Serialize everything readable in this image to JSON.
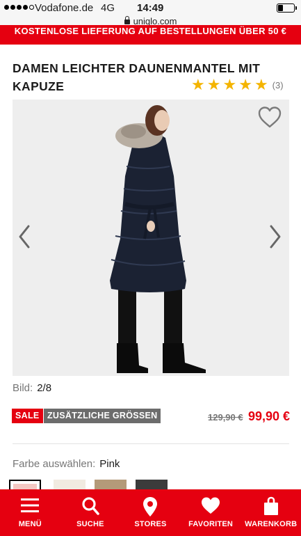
{
  "status_bar": {
    "carrier": "Vodafone.de",
    "network": "4G",
    "time": "14:49",
    "url": "uniqlo.com"
  },
  "promo_banner": {
    "text": "KOSTENLOSE LIEFERUNG AUF BESTELLUNGEN ÜBER 50 €"
  },
  "product": {
    "title": "DAMEN LEICHTER DAUNENMANTEL MIT KAPUZE",
    "rating": {
      "stars": 5,
      "filled": 5,
      "count": "(3)",
      "star_color": "#f4b400"
    },
    "image_counter": {
      "label": "Bild:",
      "value": "2/8"
    },
    "badges": {
      "sale": "SALE",
      "sizes": "ZUSÄTZLICHE GRÖSSEN"
    },
    "price": {
      "old": "129,90 €",
      "new": "99,90 €"
    },
    "color": {
      "label": "Farbe auswählen:",
      "value": "Pink"
    },
    "swatches": [
      {
        "name": "Pink",
        "hex": "#f3c8c3",
        "selected": true
      },
      {
        "name": "Off White",
        "hex": "#f1ebe1",
        "selected": false
      },
      {
        "name": "Beige",
        "hex": "#b49a79",
        "selected": false
      },
      {
        "name": "Dark Grey",
        "hex": "#3b3b3b",
        "selected": false
      }
    ]
  },
  "bottom_nav": [
    {
      "icon": "menu-icon",
      "label": "MENÜ"
    },
    {
      "icon": "search-icon",
      "label": "SUCHE"
    },
    {
      "icon": "location-pin-icon",
      "label": "STORES"
    },
    {
      "icon": "heart-icon",
      "label": "FAVORITEN"
    },
    {
      "icon": "shopping-bag-icon",
      "label": "WARENKORB"
    }
  ],
  "colors": {
    "brand_red": "#e50010",
    "badge_grey": "#6c6c6c",
    "gallery_bg": "#eeeeee"
  }
}
